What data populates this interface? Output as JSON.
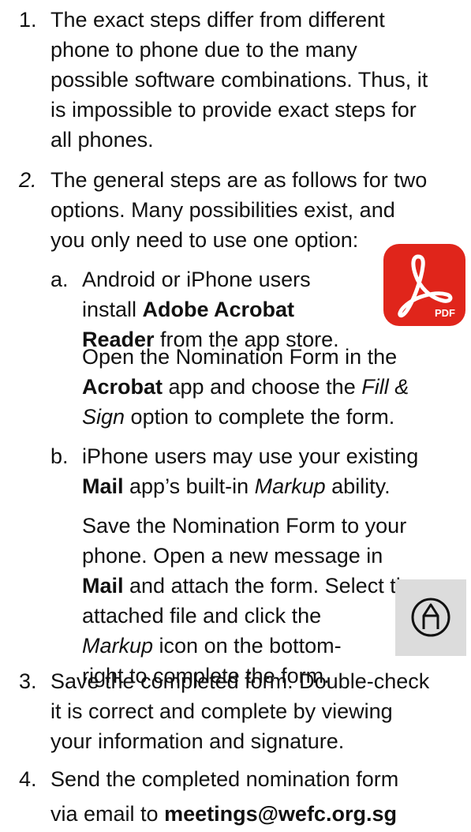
{
  "items": [
    {
      "number": "1.",
      "lines": [
        "The exact steps differ from different",
        "phone to phone due to the many",
        "possible software combinations. Thus, it",
        "is impossible to provide exact steps for",
        "all phones."
      ]
    },
    {
      "number": "2.",
      "lines": [
        "The general steps are as follows for two",
        "options. Many possibilities exist, and",
        "you only need to use one option:"
      ]
    },
    {
      "number": "3.",
      "lines": [
        "Save the completed form. Double-check",
        "it is correct and complete by viewing",
        "your information and signature."
      ]
    },
    {
      "number": "4.",
      "line1": "Send the completed nomination form",
      "line2_prefix": "via email to ",
      "email": "meetings@wefc.org.sg"
    }
  ],
  "sub_a": {
    "letter": "a.",
    "l1": "Android or iPhone users",
    "l2": "install ",
    "l2_bold": "Adobe Acrobat",
    "l3_bold": "Reader",
    "l3": " from the app store.",
    "p2_l1": "Open the Nomination Form in the",
    "p2_l2_bold": "Acrobat",
    "p2_l2": " app and choose the ",
    "p2_l2_italic": "Fill &",
    "p2_l3_italic": "Sign",
    "p2_l3": " option to complete the form."
  },
  "sub_b": {
    "letter": "b.",
    "l1": "iPhone users may use your existing",
    "l2_bold": "Mail",
    "l2": " app’s built-in ",
    "l2_italic": "Markup",
    "l2_end": " ability.",
    "p2_l1": "Save the Nomination Form to your",
    "p2_l2": "phone. Open a new message in",
    "p2_l3_bold": "Mail",
    "p2_l3": " and attach the form. Select the",
    "p2_l4": "attached file and click the",
    "p2_l5_italic": "Markup",
    "p2_l5": " icon on the bottom-",
    "p2_l6": "right to complete the form."
  },
  "icons": {
    "acrobat_icon_label": "PDF",
    "acrobat_color": "#e0251b",
    "markup_bg": "#dcdcdc"
  }
}
